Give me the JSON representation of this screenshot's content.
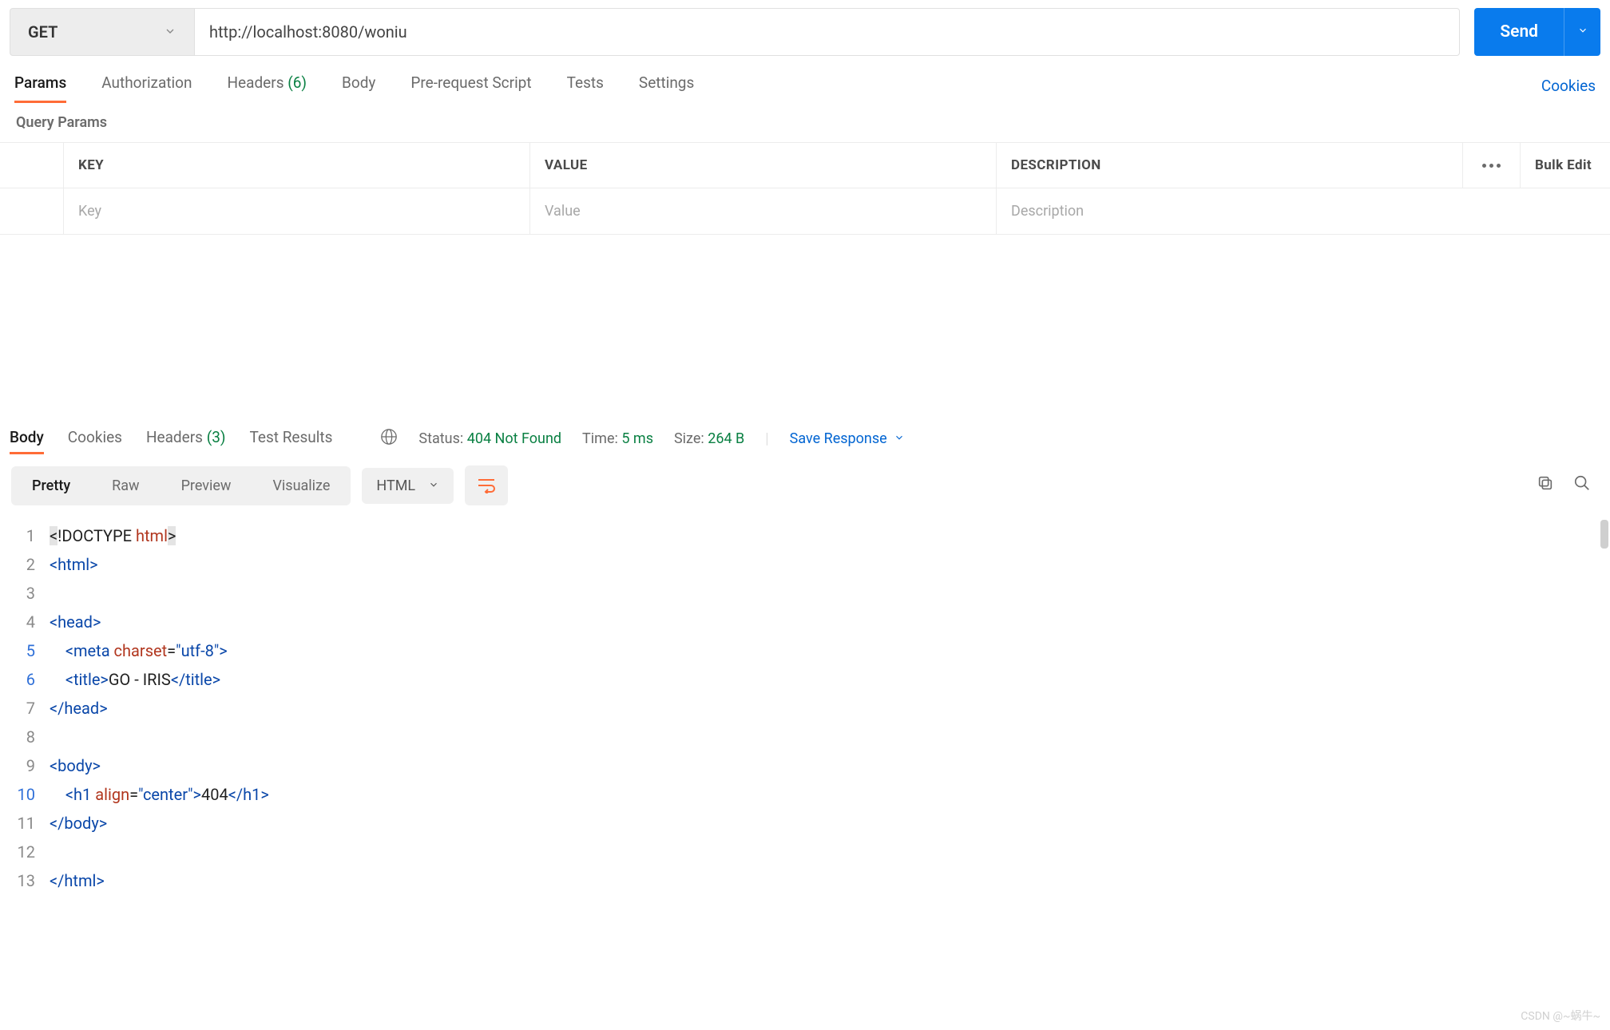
{
  "request": {
    "method": "GET",
    "url": "http://localhost:8080/woniu",
    "send_label": "Send"
  },
  "req_tabs": {
    "params": "Params",
    "authorization": "Authorization",
    "headers": "Headers",
    "headers_count": "(6)",
    "body": "Body",
    "prerequest": "Pre-request Script",
    "tests": "Tests",
    "settings": "Settings",
    "cookies": "Cookies"
  },
  "query_params": {
    "title": "Query Params",
    "cols": {
      "key": "KEY",
      "value": "VALUE",
      "description": "DESCRIPTION"
    },
    "placeholders": {
      "key": "Key",
      "value": "Value",
      "description": "Description"
    },
    "bulk_edit": "Bulk Edit"
  },
  "resp_tabs": {
    "body": "Body",
    "cookies": "Cookies",
    "headers": "Headers",
    "headers_count": "(3)",
    "test_results": "Test Results"
  },
  "resp_meta": {
    "status_label": "Status:",
    "status_value": "404 Not Found",
    "time_label": "Time:",
    "time_value": "5 ms",
    "size_label": "Size:",
    "size_value": "264 B",
    "save_response": "Save Response"
  },
  "view": {
    "pretty": "Pretty",
    "raw": "Raw",
    "preview": "Preview",
    "visualize": "Visualize",
    "lang": "HTML"
  },
  "code_lines": [
    {
      "n": "1",
      "segs": [
        {
          "c": "hl",
          "t": "<"
        },
        {
          "c": "t-txt",
          "t": "!DOCTYPE "
        },
        {
          "c": "t-dt",
          "t": "html"
        },
        {
          "c": "hl",
          "t": ">"
        }
      ]
    },
    {
      "n": "2",
      "segs": [
        {
          "c": "t-tag",
          "t": "<html>"
        }
      ]
    },
    {
      "n": "3",
      "segs": []
    },
    {
      "n": "4",
      "segs": [
        {
          "c": "t-tag",
          "t": "<head>"
        }
      ]
    },
    {
      "n": "5",
      "segs": [
        {
          "c": "t-txt",
          "t": "    "
        },
        {
          "c": "t-tag",
          "t": "<meta"
        },
        {
          "c": "t-txt",
          "t": " "
        },
        {
          "c": "t-attr",
          "t": "charset"
        },
        {
          "c": "t-txt",
          "t": "="
        },
        {
          "c": "t-str",
          "t": "\"utf-8\""
        },
        {
          "c": "t-tag",
          "t": ">"
        }
      ]
    },
    {
      "n": "6",
      "segs": [
        {
          "c": "t-txt",
          "t": "    "
        },
        {
          "c": "t-tag",
          "t": "<title>"
        },
        {
          "c": "t-txt",
          "t": "GO - IRIS"
        },
        {
          "c": "t-tag",
          "t": "</title>"
        }
      ]
    },
    {
      "n": "7",
      "segs": [
        {
          "c": "t-tag",
          "t": "</head>"
        }
      ]
    },
    {
      "n": "8",
      "segs": []
    },
    {
      "n": "9",
      "segs": [
        {
          "c": "t-tag",
          "t": "<body>"
        }
      ]
    },
    {
      "n": "10",
      "segs": [
        {
          "c": "t-txt",
          "t": "    "
        },
        {
          "c": "t-tag",
          "t": "<h1"
        },
        {
          "c": "t-txt",
          "t": " "
        },
        {
          "c": "t-attr",
          "t": "align"
        },
        {
          "c": "t-txt",
          "t": "="
        },
        {
          "c": "t-str",
          "t": "\"center\""
        },
        {
          "c": "t-tag",
          "t": ">"
        },
        {
          "c": "t-txt",
          "t": "404"
        },
        {
          "c": "t-tag",
          "t": "</h1>"
        }
      ]
    },
    {
      "n": "11",
      "segs": [
        {
          "c": "t-tag",
          "t": "</body>"
        }
      ]
    },
    {
      "n": "12",
      "segs": []
    },
    {
      "n": "13",
      "segs": [
        {
          "c": "t-tag",
          "t": "</html>"
        }
      ]
    }
  ],
  "watermark": "CSDN @~蜗牛~"
}
